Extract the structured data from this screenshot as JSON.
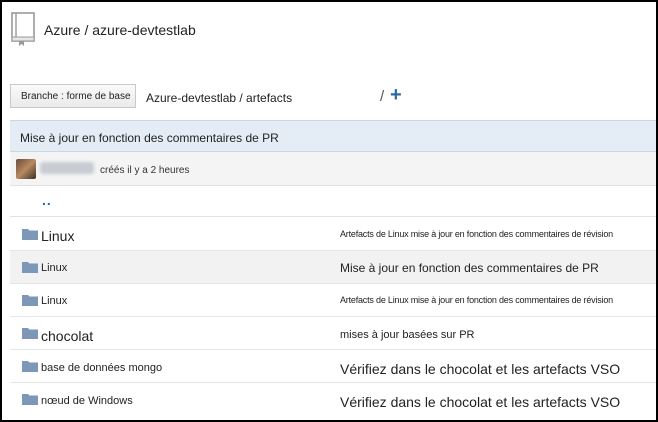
{
  "header": {
    "title": "Azure / azure-devtestlab",
    "icon": "repo-book-icon"
  },
  "toolbar": {
    "branch_label": "Branche : forme de base",
    "path": "Azure-devtestlab / artefacts",
    "slash": "/",
    "add_icon": "plus-icon"
  },
  "commit": {
    "message": "Mise à jour en fonction des commentaires de PR",
    "author_time": "créés il y a 2 heures"
  },
  "parent_link": "..",
  "files": [
    {
      "name": "Linux",
      "message": "Artefacts de Linux mise à jour en fonction des commentaires de révision"
    },
    {
      "name": "Linux",
      "message": "Mise à jour en fonction des commentaires de PR"
    },
    {
      "name": "Linux",
      "message": "Artefacts de Linux mise à jour en fonction des commentaires de révision"
    },
    {
      "name": "chocolat",
      "message": "mises à jour basées sur PR"
    },
    {
      "name": "base de données mongo",
      "message": "Vérifiez dans le chocolat et les artefacts VSO"
    },
    {
      "name": "nœud de Windows",
      "message": "Vérifiez dans le chocolat et les artefacts VSO"
    }
  ],
  "colors": {
    "link": "#2c6aa0",
    "commit_bar": "#e4edf5",
    "folder": "#7d97b8"
  }
}
